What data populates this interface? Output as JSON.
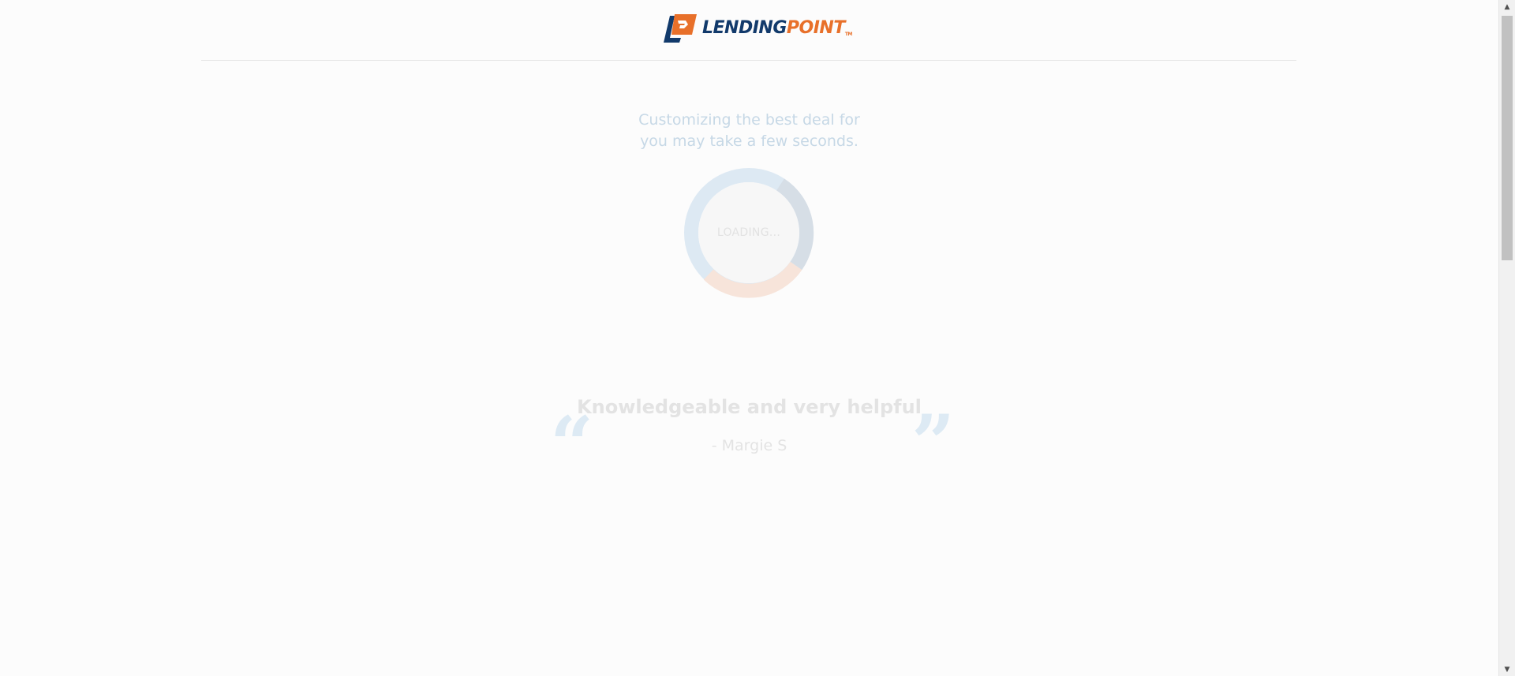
{
  "header": {
    "logo_lending": "LENDING",
    "logo_point": "POINT",
    "logo_tm": "TM"
  },
  "loading": {
    "message_line1": "Customizing the best deal for",
    "message_line2": "you may take a few seconds.",
    "spinner_label": "LOADING..."
  },
  "testimonial": {
    "quote": "Knowledgeable and very helpful",
    "author": "- Margie S",
    "open_quote_glyph": "“",
    "close_quote_glyph": "”"
  },
  "scrollbar": {
    "up_glyph": "▲",
    "down_glyph": "▼"
  },
  "colors": {
    "brand_navy": "#123a6b",
    "brand_orange": "#e8702a",
    "spinner_blue": "#dde9f3",
    "spinner_gray": "#d6dee6",
    "spinner_peach": "#f7e4da"
  }
}
